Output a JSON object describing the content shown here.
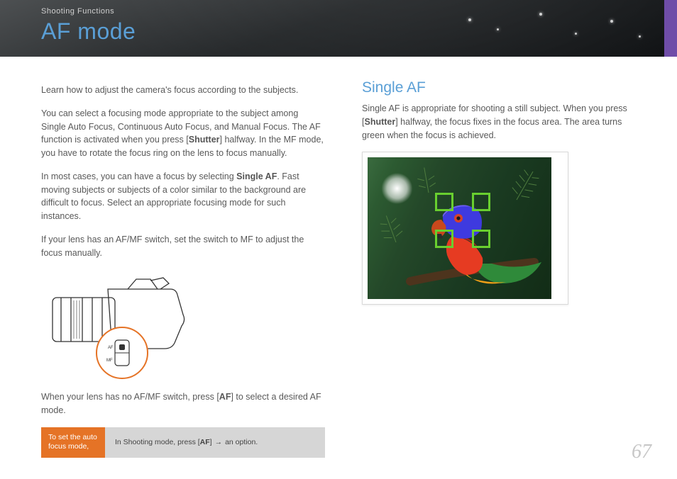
{
  "header": {
    "section_label": "Shooting Functions",
    "title": "AF mode"
  },
  "left": {
    "p1_a": "Learn how to adjust the camera's focus according to the subjects.",
    "p2_a": "You can select a focusing mode appropriate to the subject among Single Auto Focus, Continuous Auto Focus, and Manual Focus. The AF function is activated when you press [",
    "p2_b": "Shutter",
    "p2_c": "] halfway. In the MF mode, you have to rotate the focus ring on the lens to focus manually.",
    "p3_a": "In most cases, you can have a focus by selecting ",
    "p3_b": "Single AF",
    "p3_c": ". Fast moving subjects or subjects of a color similar to the background are difficult to focus. Select an appropriate focusing mode for such instances.",
    "p4": "If your lens has an AF/MF switch, set the switch to MF to adjust the focus manually.",
    "p5_a": "When your lens has no AF/MF switch, press [",
    "p5_b": "AF",
    "p5_c": "] to select a desired AF mode.",
    "camera_af_label": "AF",
    "camera_mf_label": "MF",
    "inst_label": "To set the auto focus mode,",
    "inst_body_a": "In Shooting mode, press [",
    "inst_body_b": "AF",
    "inst_body_c": "] ",
    "inst_body_d": "→",
    "inst_body_e": " an option."
  },
  "right": {
    "heading": "Single AF",
    "p1_a": "Single AF is appropriate for shooting a still subject. When you press [",
    "p1_b": "Shutter",
    "p1_c": "] halfway, the focus fixes in the focus area. The area turns green when the focus is achieved.",
    "image_alt": "Colorful parrot among green pine branches with green focus brackets"
  },
  "page_number": "67"
}
